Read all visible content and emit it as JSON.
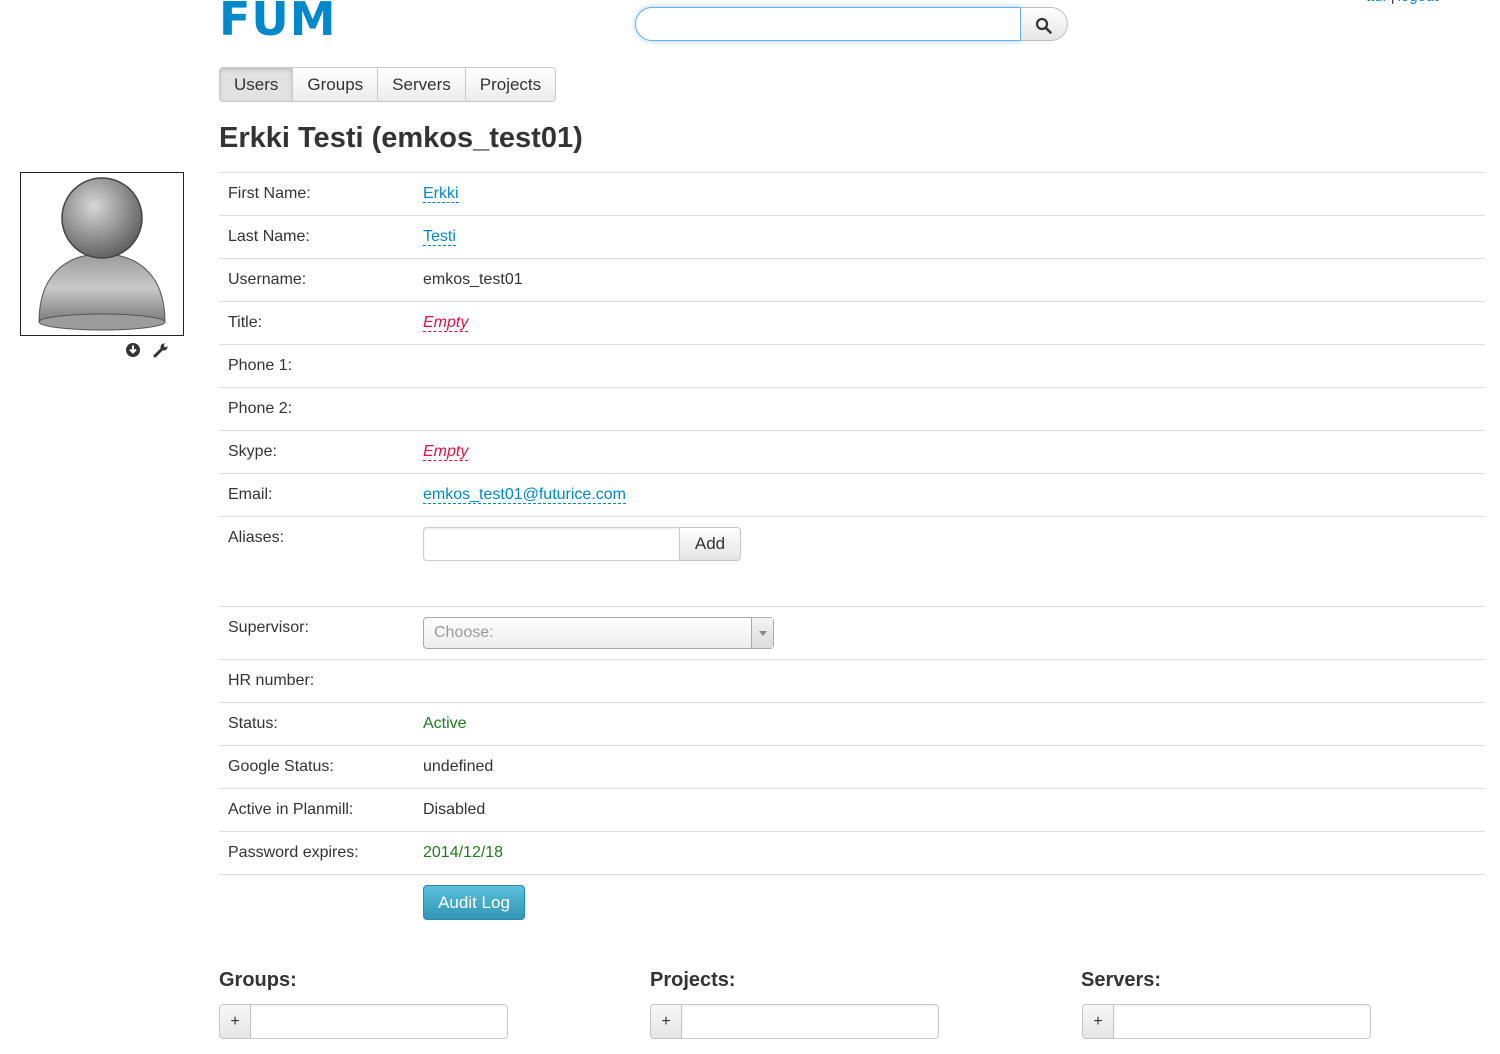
{
  "header": {
    "logo": "FUM",
    "user_link": "ttur",
    "separator": "|",
    "logout_label": "logout",
    "search_value": ""
  },
  "nav": {
    "tabs": [
      {
        "label": "Users",
        "active": true
      },
      {
        "label": "Groups",
        "active": false
      },
      {
        "label": "Servers",
        "active": false
      },
      {
        "label": "Projects",
        "active": false
      }
    ]
  },
  "page": {
    "title": "Erkki Testi (emkos_test01)"
  },
  "avatar": {
    "icon": "user-silhouette",
    "actions": [
      "download-icon",
      "wrench-icon"
    ]
  },
  "details": {
    "first_name": {
      "label": "First Name:",
      "value": "Erkki"
    },
    "last_name": {
      "label": "Last Name:",
      "value": "Testi"
    },
    "username": {
      "label": "Username:",
      "value": "emkos_test01"
    },
    "title": {
      "label": "Title:",
      "value": "Empty"
    },
    "phone1": {
      "label": "Phone 1:",
      "value": ""
    },
    "phone2": {
      "label": "Phone 2:",
      "value": ""
    },
    "skype": {
      "label": "Skype:",
      "value": "Empty"
    },
    "email": {
      "label": "Email:",
      "value": "emkos_test01@futurice.com"
    },
    "aliases": {
      "label": "Aliases:",
      "input_value": "",
      "add_label": "Add"
    },
    "supervisor": {
      "label": "Supervisor:",
      "placeholder": "Choose:"
    },
    "hr_number": {
      "label": "HR number:",
      "value": ""
    },
    "status": {
      "label": "Status:",
      "value": "Active"
    },
    "google_status": {
      "label": "Google Status:",
      "value": "undefined"
    },
    "planmill": {
      "label": "Active in Planmill:",
      "value": "Disabled"
    },
    "password_expires": {
      "label": "Password expires:",
      "value": "2014/12/18"
    },
    "audit_log_label": "Audit Log"
  },
  "sections": {
    "groups": {
      "title": "Groups:",
      "add_symbol": "+",
      "input_value": ""
    },
    "projects": {
      "title": "Projects:",
      "add_symbol": "+",
      "input_value": ""
    },
    "servers": {
      "title": "Servers:",
      "add_symbol": "+",
      "input_value": ""
    }
  },
  "colors": {
    "brand": "#0088cc",
    "empty": "#dd1144",
    "positive": "#1e7d1e",
    "info_button": "#2f96b4"
  }
}
